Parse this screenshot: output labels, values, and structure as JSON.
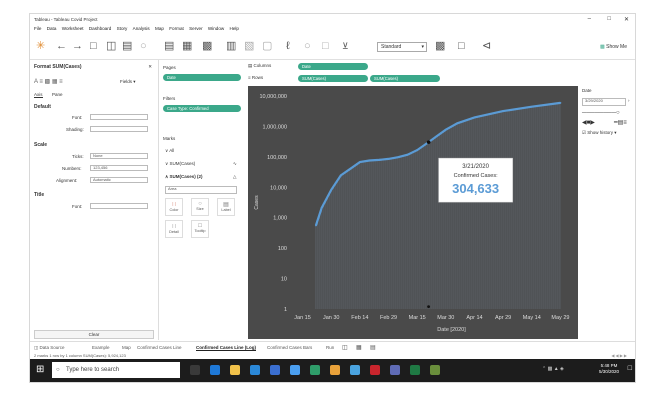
{
  "window": {
    "title": "Tableau - Tableau Covid Project"
  },
  "menu": [
    "File",
    "Data",
    "Worksheet",
    "Dashboard",
    "Story",
    "Analysis",
    "Map",
    "Format",
    "Server",
    "Window",
    "Help"
  ],
  "toolbar": {
    "fit": "Standard",
    "show_me": "Show Me"
  },
  "format_pane": {
    "title": "Format SUM(Cases)",
    "fields_label": "Fields ▾",
    "tabs": [
      "Axis",
      "Pane"
    ],
    "default_label": "Default",
    "font_label": "Font:",
    "shading_label": "Shading:",
    "scale_label": "Scale",
    "ticks_label": "Ticks:",
    "ticks_value": "None",
    "numbers_label": "Numbers:",
    "numbers_value": "123,456",
    "alignment_label": "Alignment:",
    "alignment_value": "Automatic",
    "title_label": "Title",
    "title_font_label": "Font:",
    "clear": "Clear"
  },
  "shelves": {
    "pages": "Pages",
    "filters": "Filters",
    "filter_pill": "Case Type: Confirmed",
    "date_pill": "Date",
    "marks": "Marks",
    "all": "∨ All",
    "sum_cases": "∨ SUM(Cases)",
    "sum_cases2": "∧ SUM(Cases) (2)",
    "mark_type": "Area",
    "mark_buttons": [
      "Color",
      "Size",
      "Label",
      "Detail",
      "Tooltip"
    ]
  },
  "columns": {
    "label": "Columns",
    "pill": "Date"
  },
  "rows": {
    "label": "Rows",
    "pills": [
      "SUM(Cases)",
      "SUM(Cases)"
    ]
  },
  "right_pane": {
    "title": "Date",
    "date_value": "3/29/2020",
    "show_history": "Show history ▾"
  },
  "tooltip": {
    "date": "3/21/2020",
    "label": "Confirmed Cases:",
    "value": "304,633"
  },
  "sheet_tabs": [
    "Data Source",
    "Example",
    "Map",
    "Confirmed Cases Line",
    "Confirmed Cases Line (Log)",
    "Confirmed Cases Bars",
    "Run"
  ],
  "status": {
    "text": "2 marks  1 row by 1 column  SUM(Cases): 5,924,123"
  },
  "taskbar": {
    "search": "Type here to search",
    "time": "5:48 PM",
    "date": "5/30/2020"
  },
  "colors": {
    "accent": "#3ba88a",
    "line": "#5b9bd5",
    "chart_bg": "#4a4a4a",
    "tooltip_value": "#5b9bd5"
  },
  "chart_data": {
    "type": "line",
    "xlabel": "Date [2020]",
    "ylabel": "Cases",
    "yscale": "log",
    "ylim": [
      1,
      10000000
    ],
    "y_ticks": [
      "10,000,000",
      "1,000,000",
      "100,000",
      "10,000",
      "1,000",
      "100",
      "10",
      "1"
    ],
    "x_ticks": [
      "Jan 15",
      "Jan 30",
      "Feb 14",
      "Feb 29",
      "Mar 15",
      "Mar 30",
      "Apr 14",
      "Apr 29",
      "May 14",
      "May 29"
    ],
    "series": [
      {
        "values": [
          [
            "2020-01-22",
            555
          ],
          [
            "2020-01-25",
            2118
          ],
          [
            "2020-01-30",
            8234
          ],
          [
            "2020-02-04",
            24554
          ],
          [
            "2020-02-09",
            40541
          ],
          [
            "2020-02-14",
            67100
          ],
          [
            "2020-02-19",
            75641
          ],
          [
            "2020-02-24",
            79570
          ],
          [
            "2020-02-29",
            86000
          ],
          [
            "2020-03-05",
            97800
          ],
          [
            "2020-03-10",
            118000
          ],
          [
            "2020-03-15",
            167000
          ],
          [
            "2020-03-21",
            304633
          ],
          [
            "2020-03-25",
            467000
          ],
          [
            "2020-03-30",
            782000
          ],
          [
            "2020-04-05",
            1270000
          ],
          [
            "2020-04-14",
            1975000
          ],
          [
            "2020-04-29",
            3180000
          ],
          [
            "2020-05-14",
            4440000
          ],
          [
            "2020-05-29",
            5924123
          ]
        ]
      }
    ]
  }
}
